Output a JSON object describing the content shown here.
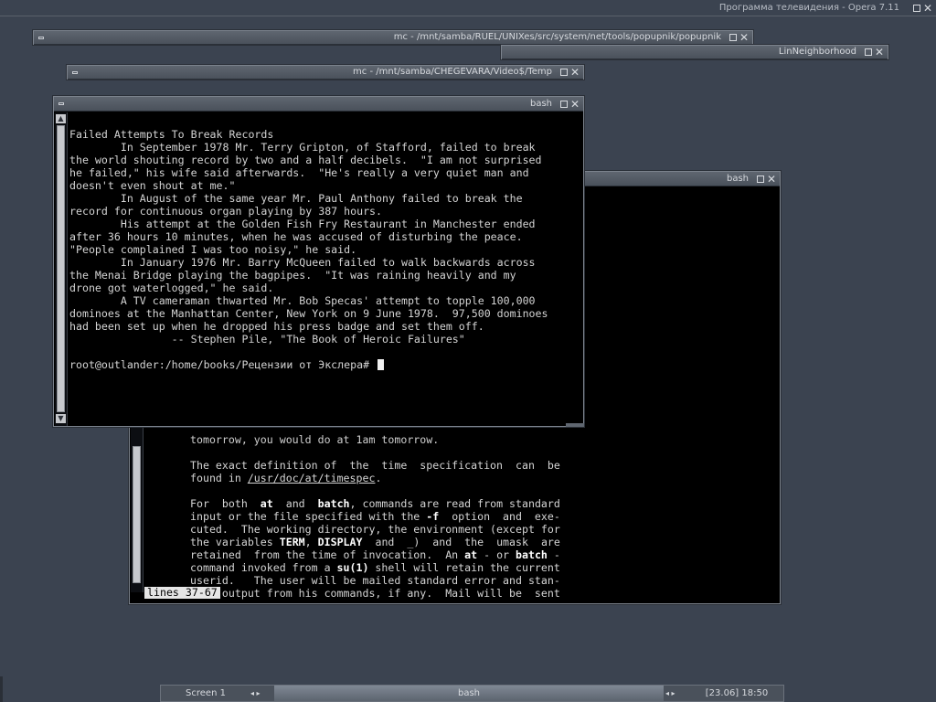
{
  "desktop": {
    "top_title": "Программа телевидения - Opera 7.11"
  },
  "windows": {
    "mc1": {
      "title": "mc - /mnt/samba/RUEL/UNIXes/src/system/net/tools/popupnik/popupnik"
    },
    "linneighborhood": {
      "title": "LinNeighborhood"
    },
    "mc2": {
      "title": "mc - /mnt/samba/CHEGEVARA/Video$/Temp"
    },
    "bash_back": {
      "title": "bash"
    },
    "bash_front": {
      "title": "bash"
    }
  },
  "front_terminal": {
    "lines": [
      "Failed Attempts To Break Records",
      "        In September 1978 Mr. Terry Gripton, of Stafford, failed to break",
      "the world shouting record by two and a half decibels.  \"I am not surprised",
      "he failed,\" his wife said afterwards.  \"He's really a very quiet man and",
      "doesn't even shout at me.\"",
      "        In August of the same year Mr. Paul Anthony failed to break the",
      "record for continuous organ playing by 387 hours.",
      "        His attempt at the Golden Fish Fry Restaurant in Manchester ended",
      "after 36 hours 10 minutes, when he was accused of disturbing the peace.",
      "\"People complained I was too noisy,\" he said.",
      "        In January 1976 Mr. Barry McQueen failed to walk backwards across",
      "the Menai Bridge playing the bagpipes.  \"It was raining heavily and my",
      "drone got waterlogged,\" he said.",
      "        A TV cameraman thwarted Mr. Bob Specas' attempt to topple 100,000",
      "dominoes at the Manhattan Center, New York on 9 June 1978.  97,500 dominoes",
      "had been set up when he dropped his press badge and set them off.",
      "                -- Stephen Pile, \"The Book of Heroic Failures\"",
      ""
    ],
    "prompt": "root@outlander:/home/books/Рецензии от Экслера# "
  },
  "back_terminal": {
    "partial_line": "tomorrow, you would do at 1am tomorrow.",
    "p1_line1": "The exact definition of  the  time  specification  can  be",
    "p1_line2_pre": "found in ",
    "p1_line2_link": "/usr/doc/at/timespec",
    "p1_line2_post": ".",
    "p2": {
      "l1_a": "For  both  ",
      "l1_at": "at",
      "l1_b": "  and  ",
      "l1_batch": "batch",
      "l1_c": ", commands are read from standard",
      "l2_a": "input or the file specified with the ",
      "l2_f": "-f",
      "l2_b": "  option  and  exe-",
      "l3": "cuted.  The working directory, the environment (except for",
      "l4_a": "the variables ",
      "l4_term": "TERM",
      "l4_b": ", ",
      "l4_display": "DISPLAY",
      "l4_c": "  and  _)  and  the  umask  are",
      "l5_a": "retained  from the time of invocation.  An ",
      "l5_at": "at",
      "l5_b": " - or ",
      "l5_batch": "batch",
      "l5_c": " -",
      "l6_a": "command invoked from a ",
      "l6_su": "su(1)",
      "l6_b": " shell will retain the current",
      "l7": "userid.   The user will be mailed standard error and stan-",
      "l8": "dard output from his commands, if any.  Mail will be  sent"
    },
    "status": "lines 37-67 "
  },
  "taskbar": {
    "screen_label": "Screen 1",
    "active_label": "bash",
    "clock": "[23.06] 18:50",
    "arrows": "◂ ▸"
  }
}
